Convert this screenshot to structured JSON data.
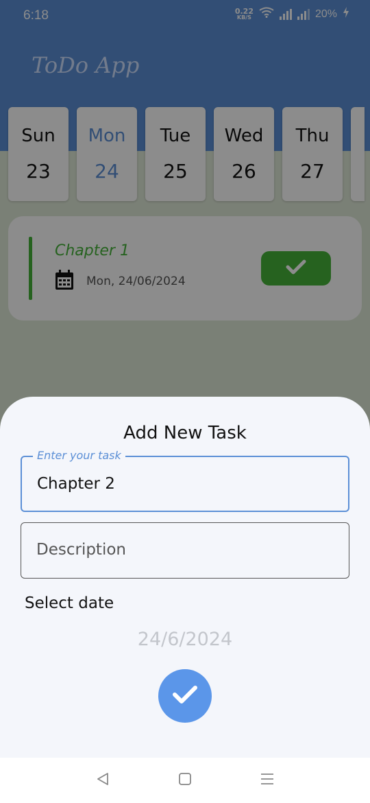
{
  "status_bar": {
    "time": "6:18",
    "net_speed_value": "0.22",
    "net_speed_unit": "KB/S",
    "battery": "20%"
  },
  "app": {
    "title": "ToDo App",
    "colors": {
      "primary": "#5b8fd6",
      "accent_green": "#45b33a"
    }
  },
  "days": [
    {
      "name": "Sun",
      "num": "23",
      "selected": false
    },
    {
      "name": "Mon",
      "num": "24",
      "selected": true
    },
    {
      "name": "Tue",
      "num": "25",
      "selected": false
    },
    {
      "name": "Wed",
      "num": "26",
      "selected": false
    },
    {
      "name": "Thu",
      "num": "27",
      "selected": false
    }
  ],
  "task": {
    "title": "Chapter 1",
    "date": "Mon, 24/06/2024",
    "icons": {
      "date": "calendar-icon",
      "done": "check-icon"
    }
  },
  "sheet": {
    "title": "Add New Task",
    "task_field": {
      "label": "Enter your task",
      "value": "Chapter 2"
    },
    "description_field": {
      "placeholder": "Description",
      "value": ""
    },
    "select_date_label": "Select date",
    "date_value": "24/6/2024",
    "submit_icon": "check-icon"
  },
  "nav": {
    "icons": [
      "back-icon",
      "home-icon",
      "menu-icon"
    ]
  }
}
